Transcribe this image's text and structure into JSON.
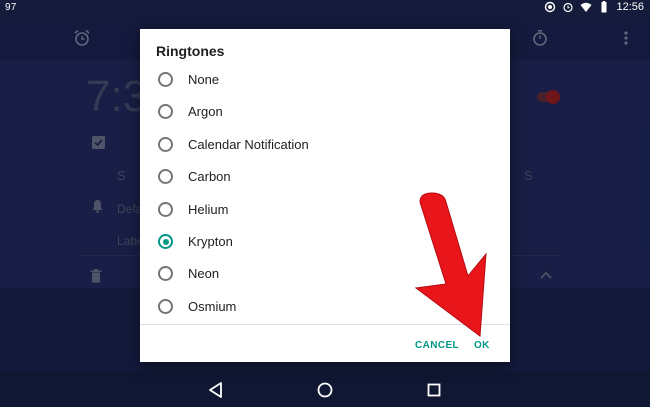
{
  "status_bar": {
    "left_text": "97",
    "time": "12:56"
  },
  "background_app": {
    "alarm_time": "7:3",
    "day_left": "S",
    "day_right": "S",
    "ringtone_text": "Defa",
    "label_text": "Labe"
  },
  "dialog": {
    "title": "Ringtones",
    "options": [
      {
        "label": "None",
        "selected": false
      },
      {
        "label": "Argon",
        "selected": false
      },
      {
        "label": "Calendar Notification",
        "selected": false
      },
      {
        "label": "Carbon",
        "selected": false
      },
      {
        "label": "Helium",
        "selected": false
      },
      {
        "label": "Krypton",
        "selected": true
      },
      {
        "label": "Neon",
        "selected": false
      },
      {
        "label": "Osmium",
        "selected": false
      }
    ],
    "cancel_label": "CANCEL",
    "ok_label": "OK"
  },
  "colors": {
    "accent": "#009688",
    "arrow": "#e8151b",
    "toolbar": "#232d6a"
  },
  "icons": [
    "alarm-icon",
    "stopwatch-icon",
    "more-vert-icon",
    "checkbox-icon",
    "bell-icon",
    "trash-icon",
    "chevron-up-icon",
    "back-icon",
    "home-icon",
    "recents-icon",
    "wifi-icon",
    "battery-icon"
  ]
}
